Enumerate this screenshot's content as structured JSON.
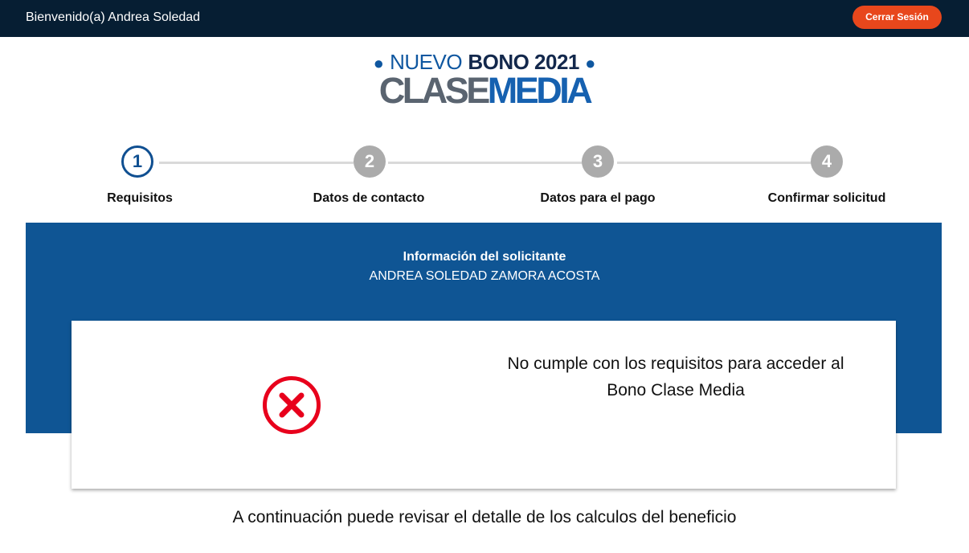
{
  "header": {
    "welcome_text": "Bienvenido(a) Andrea Soledad",
    "logout_label": "Cerrar Sesión"
  },
  "logo": {
    "line1_prefix": "NUEVO",
    "line1_main": "BONO 2021",
    "line2_a": "CLASE",
    "line2_b": "MEDIA"
  },
  "stepper": {
    "steps": [
      {
        "number": "1",
        "label": "Requisitos",
        "state": "active"
      },
      {
        "number": "2",
        "label": "Datos de contacto",
        "state": "inactive"
      },
      {
        "number": "3",
        "label": "Datos para el pago",
        "state": "inactive"
      },
      {
        "number": "4",
        "label": "Confirmar solicitud",
        "state": "inactive"
      }
    ]
  },
  "applicant": {
    "title": "Información del solicitante",
    "name": "ANDREA SOLEDAD ZAMORA ACOSTA"
  },
  "result": {
    "icon": "error-x-icon",
    "line1": "No cumple con los requisitos para acceder al",
    "line2": "Bono Clase Media"
  },
  "footer": {
    "text": "A continuación puede revisar el detalle de los calculos del beneficio"
  },
  "colors": {
    "topbar": "#061e33",
    "logout_button": "#e8471c",
    "primary_blue": "#0f5594",
    "active_step": "#0f4f91",
    "inactive_step": "#ababab",
    "error_red": "#e8001c"
  }
}
